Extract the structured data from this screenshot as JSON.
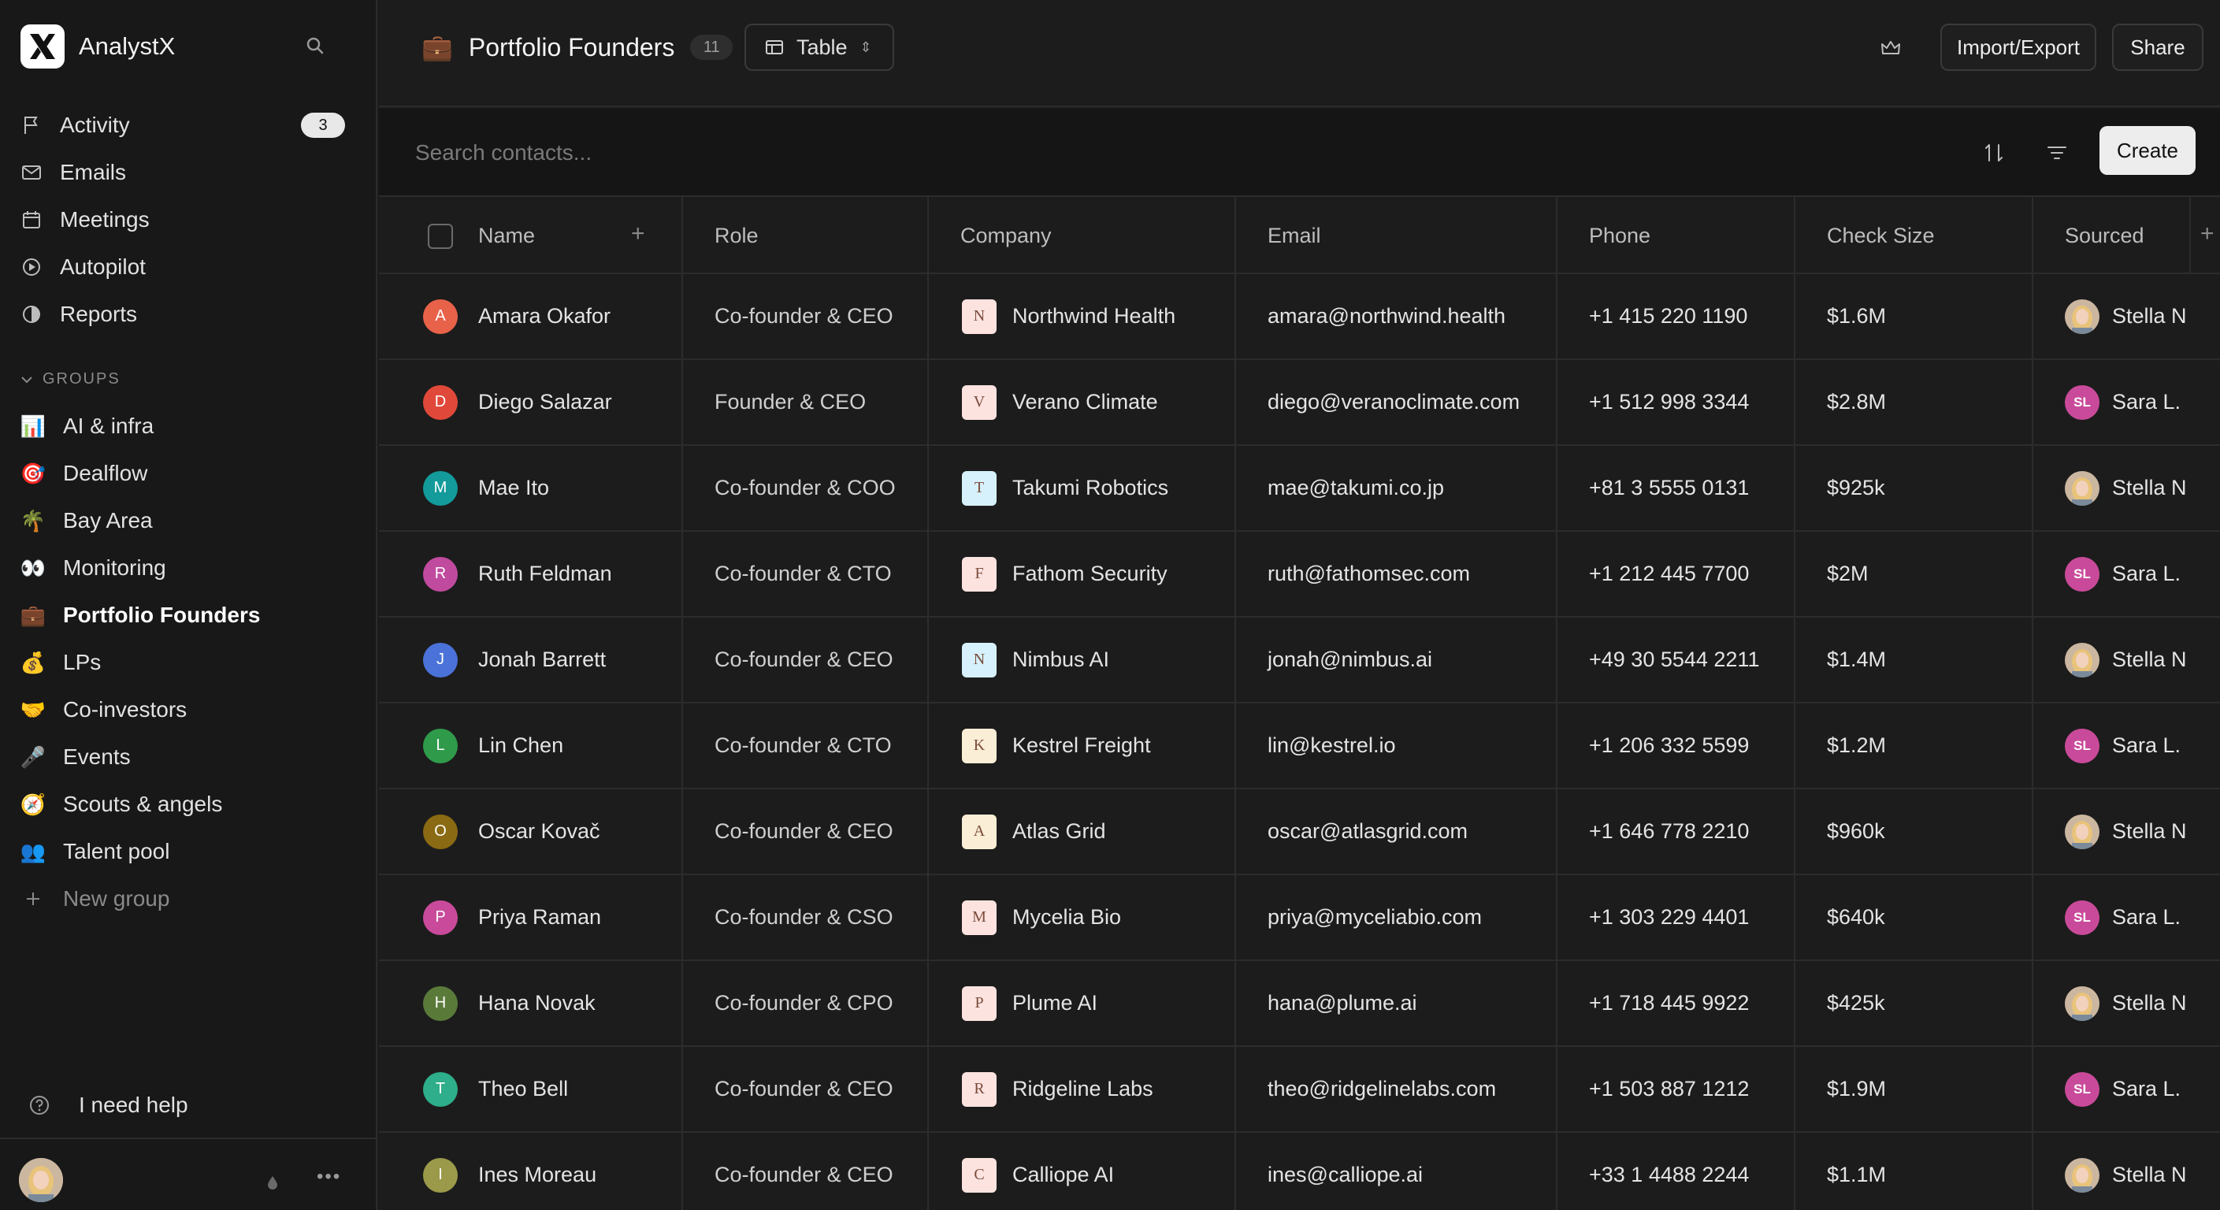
{
  "app": {
    "name": "AnalystX"
  },
  "sidebar": {
    "nav": [
      {
        "label": "Activity",
        "icon": "flag-icon",
        "badge": "3"
      },
      {
        "label": "Emails",
        "icon": "mail-icon"
      },
      {
        "label": "Meetings",
        "icon": "calendar-icon"
      },
      {
        "label": "Autopilot",
        "icon": "play-circle-icon"
      },
      {
        "label": "Reports",
        "icon": "pie-chart-icon"
      }
    ],
    "groups_header": "GROUPS",
    "groups": [
      {
        "label": "AI & infra",
        "emoji": "📊"
      },
      {
        "label": "Dealflow",
        "emoji": "🎯"
      },
      {
        "label": "Bay Area",
        "emoji": "🌴"
      },
      {
        "label": "Monitoring",
        "emoji": "👀"
      },
      {
        "label": "Portfolio Founders",
        "emoji": "💼"
      },
      {
        "label": "LPs",
        "emoji": "💰"
      },
      {
        "label": "Co-investors",
        "emoji": "🤝"
      },
      {
        "label": "Events",
        "emoji": "🎤"
      },
      {
        "label": "Scouts & angels",
        "emoji": "🧭"
      },
      {
        "label": "Talent pool",
        "emoji": "👥"
      }
    ],
    "new_group": "New group",
    "help": "I need help"
  },
  "header": {
    "emoji": "💼",
    "title": "Portfolio Founders",
    "count": "11",
    "view": "Table",
    "import_export": "Import/Export",
    "share": "Share"
  },
  "search": {
    "placeholder": "Search contacts...",
    "create": "Create"
  },
  "table": {
    "columns": [
      "Name",
      "Role",
      "Company",
      "Email",
      "Phone",
      "Check Size",
      "Sourced"
    ],
    "rows": [
      {
        "initial": "A",
        "color": "#e8624a",
        "name": "Amara Okafor",
        "role": "Co-founder & CEO",
        "logo": "N",
        "logo_bg": "#fde3e0",
        "company": "Northwind Health",
        "email": "amara@northwind.health",
        "phone": "+1 415 220 1190",
        "check": "$1.6M",
        "sourced_initials": "",
        "sourced": "Stella N"
      },
      {
        "initial": "D",
        "color": "#e0483a",
        "name": "Diego Salazar",
        "role": "Founder & CEO",
        "logo": "V",
        "logo_bg": "#fde3e0",
        "company": "Verano Climate",
        "email": "diego@veranoclimate.com",
        "phone": "+1 512 998 3344",
        "check": "$2.8M",
        "sourced_initials": "SL",
        "sourced": "Sara L."
      },
      {
        "initial": "M",
        "color": "#139a9a",
        "name": "Mae Ito",
        "role": "Co-founder & COO",
        "logo": "T",
        "logo_bg": "#d6f1fb",
        "company": "Takumi Robotics",
        "email": "mae@takumi.co.jp",
        "phone": "+81 3 5555 0131",
        "check": "$925k",
        "sourced_initials": "",
        "sourced": "Stella N"
      },
      {
        "initial": "R",
        "color": "#c04a9e",
        "name": "Ruth Feldman",
        "role": "Co-founder & CTO",
        "logo": "F",
        "logo_bg": "#fde3e0",
        "company": "Fathom Security",
        "email": "ruth@fathomsec.com",
        "phone": "+1 212 445 7700",
        "check": "$2M",
        "sourced_initials": "SL",
        "sourced": "Sara L."
      },
      {
        "initial": "J",
        "color": "#4a72d8",
        "name": "Jonah Barrett",
        "role": "Co-founder & CEO",
        "logo": "N",
        "logo_bg": "#d6f1fb",
        "company": "Nimbus AI",
        "email": "jonah@nimbus.ai",
        "phone": "+49 30 5544 2211",
        "check": "$1.4M",
        "sourced_initials": "",
        "sourced": "Stella N"
      },
      {
        "initial": "L",
        "color": "#2e9a4a",
        "name": "Lin Chen",
        "role": "Co-founder & CTO",
        "logo": "K",
        "logo_bg": "#fbeed6",
        "company": "Kestrel Freight",
        "email": "lin@kestrel.io",
        "phone": "+1 206 332 5599",
        "check": "$1.2M",
        "sourced_initials": "SL",
        "sourced": "Sara L."
      },
      {
        "initial": "O",
        "color": "#8a6a12",
        "name": "Oscar Kovač",
        "role": "Co-founder & CEO",
        "logo": "A",
        "logo_bg": "#fbeed6",
        "company": "Atlas Grid",
        "email": "oscar@atlasgrid.com",
        "phone": "+1 646 778 2210",
        "check": "$960k",
        "sourced_initials": "",
        "sourced": "Stella N"
      },
      {
        "initial": "P",
        "color": "#c94a9a",
        "name": "Priya Raman",
        "role": "Co-founder & CSO",
        "logo": "M",
        "logo_bg": "#fde3e0",
        "company": "Mycelia Bio",
        "email": "priya@myceliabio.com",
        "phone": "+1 303 229 4401",
        "check": "$640k",
        "sourced_initials": "SL",
        "sourced": "Sara L."
      },
      {
        "initial": "H",
        "color": "#5a7a3a",
        "name": "Hana Novak",
        "role": "Co-founder & CPO",
        "logo": "P",
        "logo_bg": "#fde3e0",
        "company": "Plume AI",
        "email": "hana@plume.ai",
        "phone": "+1 718 445 9922",
        "check": "$425k",
        "sourced_initials": "",
        "sourced": "Stella N"
      },
      {
        "initial": "T",
        "color": "#2eae8a",
        "name": "Theo Bell",
        "role": "Co-founder & CEO",
        "logo": "R",
        "logo_bg": "#fde3e0",
        "company": "Ridgeline Labs",
        "email": "theo@ridgelinelabs.com",
        "phone": "+1 503 887 1212",
        "check": "$1.9M",
        "sourced_initials": "SL",
        "sourced": "Sara L."
      },
      {
        "initial": "I",
        "color": "#9a9a4a",
        "name": "Ines Moreau",
        "role": "Co-founder & CEO",
        "logo": "C",
        "logo_bg": "#fde3e0",
        "company": "Calliope AI",
        "email": "ines@calliope.ai",
        "phone": "+33 1 4488 2244",
        "check": "$1.1M",
        "sourced_initials": "",
        "sourced": "Stella N"
      }
    ]
  },
  "colors": {
    "sara_avatar": "#c94a9a",
    "background": "#1c1c1c",
    "sidebar": "#181818"
  }
}
